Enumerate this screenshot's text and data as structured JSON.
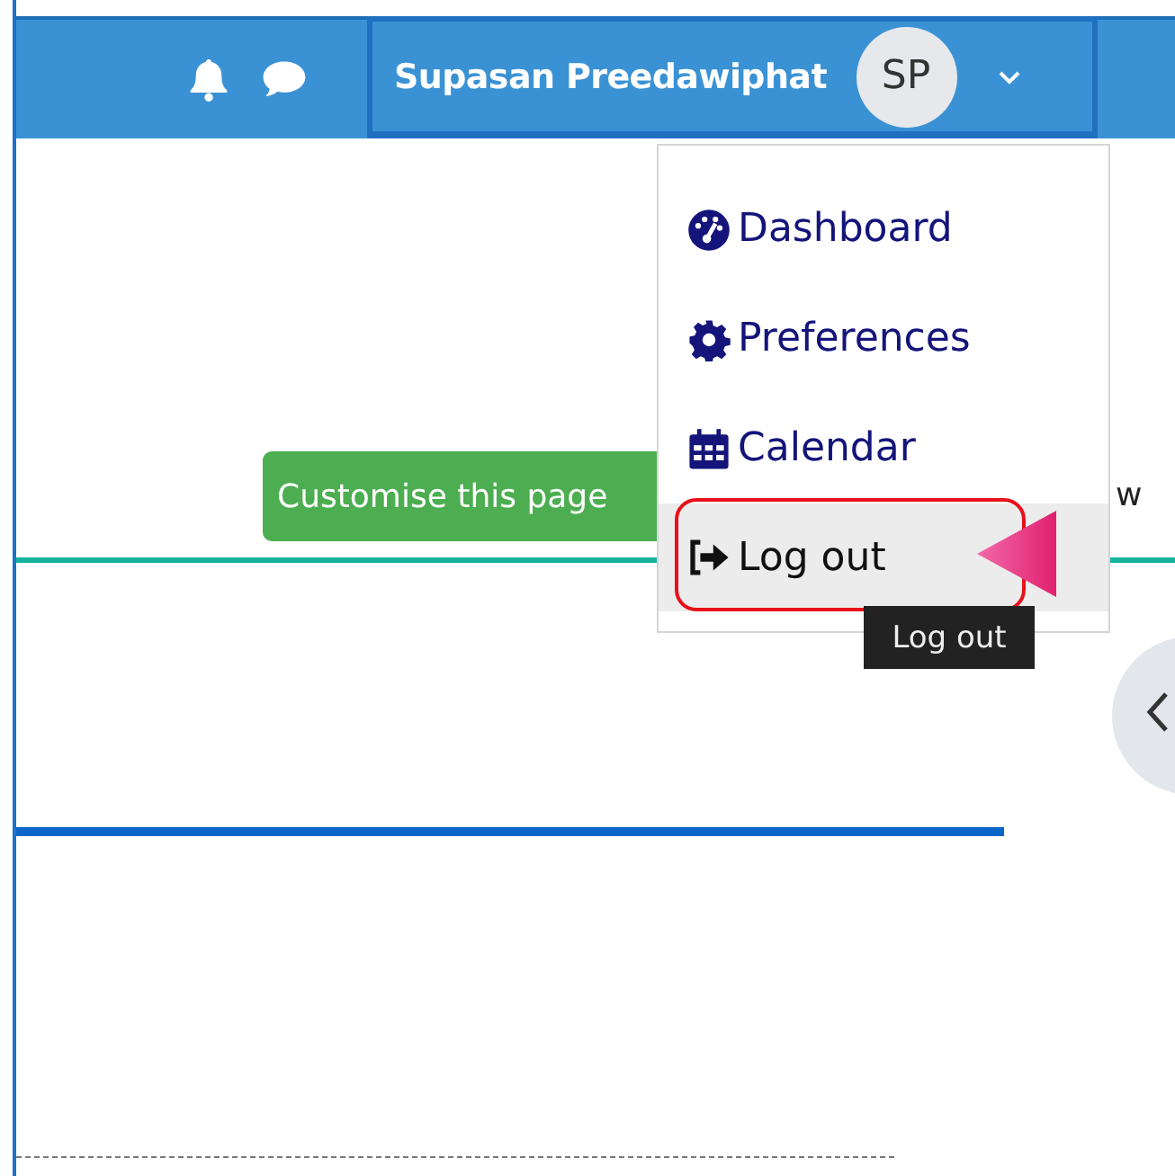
{
  "header": {
    "user_name": "Supasan Preedawiphat",
    "avatar_initials": "SP"
  },
  "page": {
    "customise_button": "Customise this page",
    "partial_text": "w"
  },
  "user_menu": {
    "expanded": true,
    "items": [
      {
        "kind": "dashboard",
        "label": "Dashboard",
        "selected": false
      },
      {
        "kind": "preferences",
        "label": "Preferences",
        "selected": false
      },
      {
        "kind": "calendar",
        "label": "Calendar",
        "selected": false
      },
      {
        "kind": "logout",
        "label": "Log out",
        "selected": true
      }
    ]
  },
  "tooltip": "Log out"
}
